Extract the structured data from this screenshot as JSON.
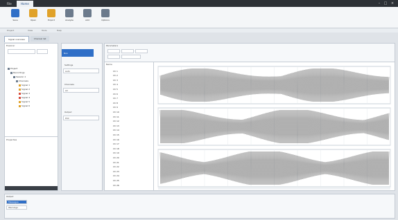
{
  "app": {
    "title": "",
    "tabs": [
      {
        "label": "File"
      },
      {
        "label": "Home"
      }
    ]
  },
  "ribbon": {
    "buttons": [
      {
        "label": "Save",
        "color": "#2f6fc7"
      },
      {
        "label": "Open",
        "color": "#e0a22a"
      },
      {
        "label": "Export",
        "color": "#e0a22a"
      },
      {
        "label": "Analyze",
        "color": "#6b7a8c"
      },
      {
        "label": "Add",
        "color": "#6b7a8c"
      },
      {
        "label": "Options",
        "color": "#6b7a8c"
      }
    ]
  },
  "subbar": {
    "items": [
      "Project",
      "View",
      "Tools",
      "Help"
    ]
  },
  "document_tabs": [
    {
      "label": "Signal overview"
    },
    {
      "label": "Channel list"
    }
  ],
  "left_panel": {
    "header": "Explorer",
    "search_placeholder": "",
    "tree": [
      {
        "label": "Project"
      },
      {
        "label": "Recordings"
      },
      {
        "label": "Session 1"
      },
      {
        "label": "Channels"
      },
      {
        "label": "Signal 1"
      },
      {
        "label": "Signal 2"
      },
      {
        "label": "Signal 3"
      },
      {
        "label": "Signal 4"
      },
      {
        "label": "Signal 5"
      },
      {
        "label": "Signal 6"
      }
    ],
    "footer_header": "Properties"
  },
  "mid_panel": {
    "button_label": "Run",
    "section1": "Settings",
    "value1": "Auto",
    "section2": "Channels",
    "value2": "All",
    "section3": "Output",
    "value3": "Plot"
  },
  "props": {
    "header": "Parameters"
  },
  "list": {
    "header": "Name",
    "items": [
      "Ch 1",
      "Ch 2",
      "Ch 3",
      "Ch 4",
      "Ch 5",
      "Ch 6",
      "Ch 7",
      "Ch 8",
      "Ch 9",
      "Ch 10",
      "Ch 11",
      "Ch 12",
      "Ch 13",
      "Ch 14",
      "Ch 15",
      "Ch 16",
      "Ch 17",
      "Ch 18",
      "Ch 19",
      "Ch 20",
      "Ch 21",
      "Ch 22",
      "Ch 23",
      "Ch 24",
      "Ch 25",
      "Ch 26"
    ]
  },
  "plots": {
    "channels": [
      {
        "label": ""
      },
      {
        "label": ""
      },
      {
        "label": ""
      }
    ]
  },
  "bottom": {
    "header": "Output",
    "items": [
      "Messages",
      "Warnings"
    ],
    "status": ""
  }
}
